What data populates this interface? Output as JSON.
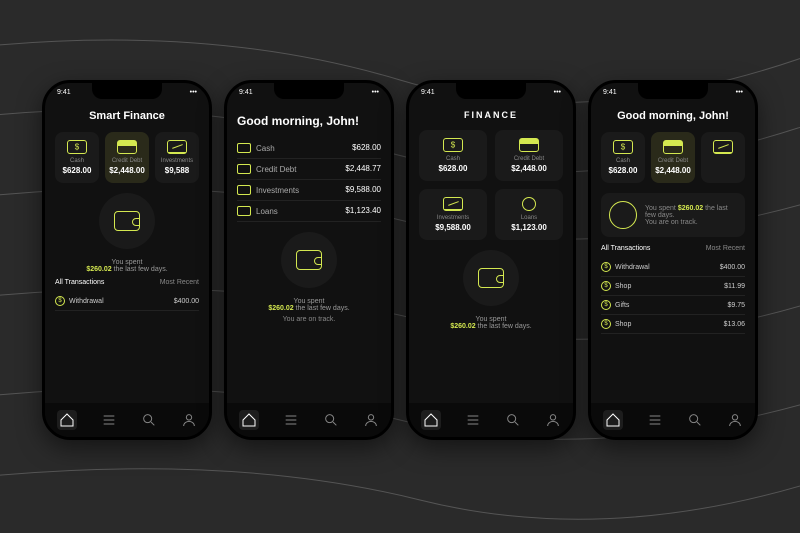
{
  "status_time": "9:41",
  "screens": {
    "s1": {
      "title": "Smart Finance",
      "cards": [
        {
          "label": "Cash",
          "value": "$628.00"
        },
        {
          "label": "Credit Debt",
          "value": "$2,448.00"
        },
        {
          "label": "Investments",
          "value": "$9,588"
        }
      ],
      "spent_prefix": "You spent",
      "spent_amount": "$260.02",
      "spent_suffix": "the last few days.",
      "tabs": [
        "All Transactions",
        "Most Recent"
      ],
      "tx": {
        "name": "Withdrawal",
        "amount": "$400.00"
      }
    },
    "s2": {
      "title": "Good morning, John!",
      "rows": [
        {
          "label": "Cash",
          "value": "$628.00"
        },
        {
          "label": "Credit Debt",
          "value": "$2,448.77"
        },
        {
          "label": "Investments",
          "value": "$9,588.00"
        },
        {
          "label": "Loans",
          "value": "$1,123.40"
        }
      ],
      "spent_prefix": "You spent",
      "spent_amount": "$260.02",
      "spent_suffix": "the last few days.",
      "track": "You are on track."
    },
    "s3": {
      "brand": "FINANCE",
      "cards": [
        {
          "label": "Cash",
          "value": "$628.00"
        },
        {
          "label": "Credit Debt",
          "value": "$2,448.00"
        },
        {
          "label": "Investments",
          "value": "$9,588.00"
        },
        {
          "label": "Loans",
          "value": "$1,123.00"
        }
      ],
      "spent_prefix": "You spent",
      "spent_amount": "$260.02",
      "spent_suffix": "the last few days."
    },
    "s4": {
      "title": "Good morning, John!",
      "cards": [
        {
          "label": "Cash",
          "value": "$628.00"
        },
        {
          "label": "Credit Debt",
          "value": "$2,448.00"
        },
        {
          "label": "",
          "value": ""
        }
      ],
      "spent_prefix": "You spent",
      "spent_amount": "$260.02",
      "spent_suffix": "the last few days.",
      "track": "You are on track.",
      "tabs": [
        "All Transactions",
        "Most Recent"
      ],
      "tx": [
        {
          "name": "Withdrawal",
          "amount": "$400.00"
        },
        {
          "name": "Shop",
          "amount": "$11.99"
        },
        {
          "name": "Gifts",
          "amount": "$9.75"
        },
        {
          "name": "Shop",
          "amount": "$13.06"
        }
      ]
    }
  },
  "nav": [
    "home",
    "list",
    "search",
    "profile"
  ]
}
